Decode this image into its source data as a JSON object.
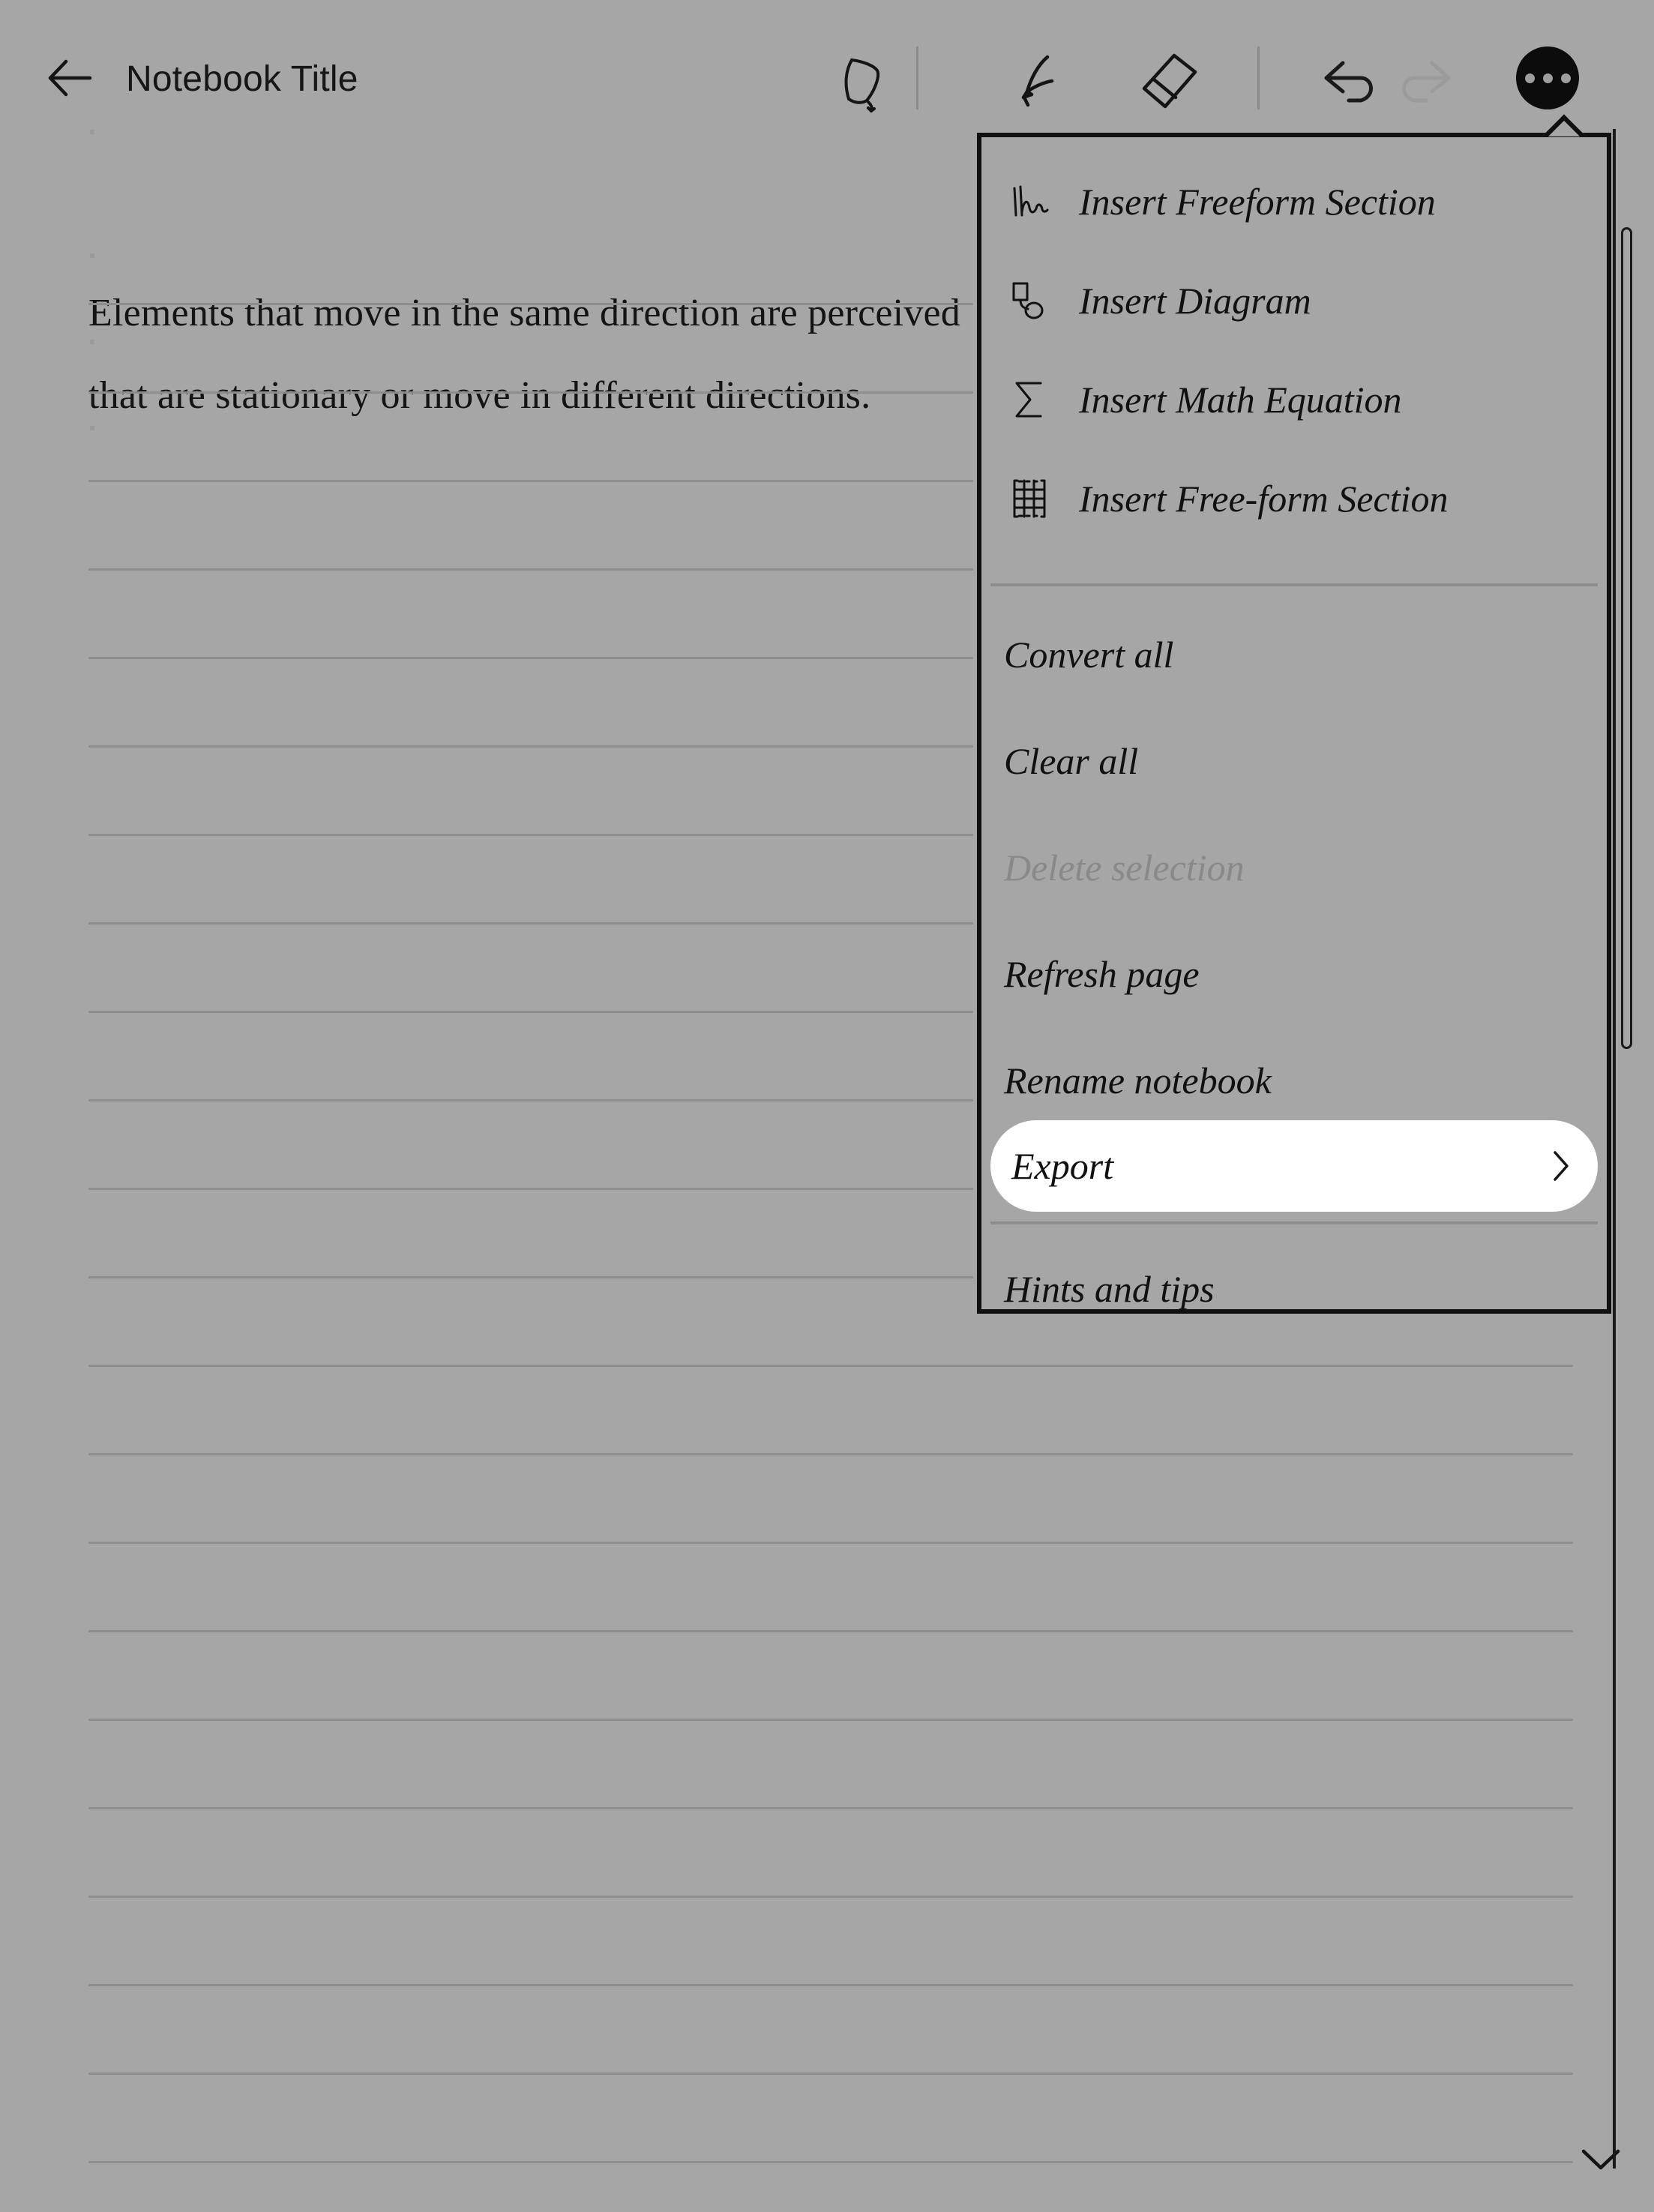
{
  "topbar": {
    "back_icon": "back-arrow-icon",
    "title": "Notebook Title",
    "tools": [
      {
        "name": "lasso-select-icon",
        "state": "enabled"
      },
      {
        "name": "pen-icon",
        "state": "enabled"
      },
      {
        "name": "eraser-icon",
        "state": "enabled"
      },
      {
        "name": "undo-icon",
        "state": "enabled"
      },
      {
        "name": "redo-icon",
        "state": "disabled"
      }
    ],
    "more_button": "more-options-icon"
  },
  "page": {
    "paragraphs": [
      "Elements that move in the same direction are perceived",
      "that are stationary or move in different directions."
    ],
    "scroll_down_icon": "chevron-down-icon"
  },
  "menu": {
    "groups": [
      {
        "items": [
          {
            "icon": "freeform-scribble-icon",
            "label": "Insert Freeform Section",
            "disabled": false,
            "selected": false
          },
          {
            "icon": "diagram-shapes-icon",
            "label": "Insert Diagram",
            "disabled": false,
            "selected": false
          },
          {
            "icon": "sigma-math-icon",
            "label": "Insert Math Equation",
            "disabled": false,
            "selected": false
          },
          {
            "icon": "table-grid-icon",
            "label": "Insert Free-form Section",
            "disabled": false,
            "selected": false
          }
        ]
      },
      {
        "items": [
          {
            "icon": null,
            "label": "Convert all",
            "disabled": false,
            "selected": false
          },
          {
            "icon": null,
            "label": "Clear all",
            "disabled": false,
            "selected": false
          },
          {
            "icon": null,
            "label": "Delete selection",
            "disabled": true,
            "selected": false
          },
          {
            "icon": null,
            "label": "Refresh page",
            "disabled": false,
            "selected": false
          },
          {
            "icon": null,
            "label": "Rename notebook",
            "disabled": false,
            "selected": false
          },
          {
            "icon": null,
            "label": "Export",
            "disabled": false,
            "selected": true,
            "submenu_icon": "chevron-right-icon"
          }
        ]
      },
      {
        "items": [
          {
            "icon": null,
            "label": "Hints and tips",
            "disabled": false,
            "selected": false
          }
        ]
      }
    ]
  },
  "colors": {
    "background": "#a6a6a6",
    "ink": "#111111",
    "disabled_text": "#898989",
    "rule_line": "#8e8e8e",
    "menu_border": "#101010",
    "selected_bg": "#ffffff",
    "more_button_bg": "#0c0c0c"
  }
}
